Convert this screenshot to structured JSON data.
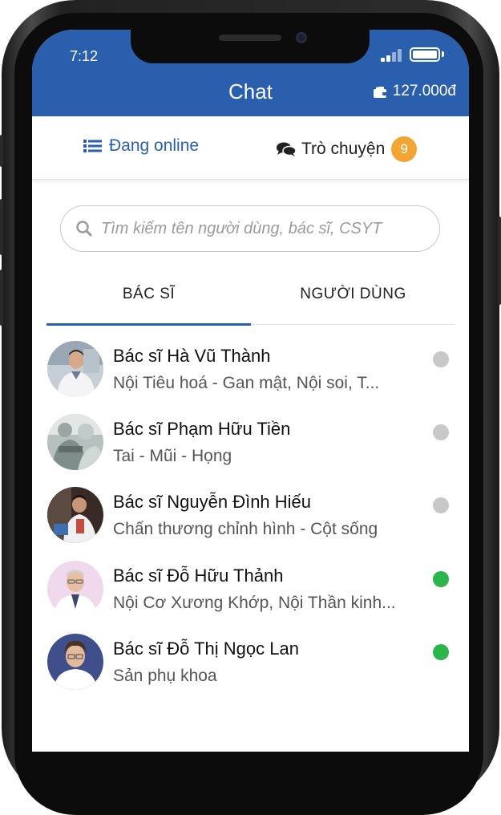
{
  "status_bar": {
    "time": "7:12"
  },
  "header": {
    "title": "Chat",
    "wallet_amount": "127.000đ"
  },
  "top_tabs": {
    "online_label": "Đang online",
    "chat_label": "Trò chuyện",
    "chat_badge": "9"
  },
  "search": {
    "placeholder": "Tìm kiếm tên người dùng, bác sĩ, CSYT"
  },
  "sub_tabs": {
    "doctors_label": "BÁC SĨ",
    "users_label": "NGƯỜI DÙNG",
    "active": "doctors"
  },
  "doctors": [
    {
      "name": "Bác sĩ Hà Vũ Thành",
      "specialty": "Nội Tiêu hoá - Gan mật, Nội soi, T...",
      "online": false
    },
    {
      "name": "Bác sĩ Phạm Hữu Tiền",
      "specialty": "Tai - Mũi - Họng",
      "online": false
    },
    {
      "name": "Bác sĩ Nguyễn Đình Hiếu",
      "specialty": "Chấn thương chỉnh hình - Cột sống",
      "online": false
    },
    {
      "name": "Bác sĩ Đỗ Hữu Thảnh",
      "specialty": "Nội Cơ Xương Khớp, Nội Thần kinh...",
      "online": true
    },
    {
      "name": "Bác sĩ Đỗ Thị Ngọc Lan",
      "specialty": "Sản phụ khoa",
      "online": true
    }
  ],
  "colors": {
    "primary": "#2a5fad",
    "badge": "#f2a532",
    "online": "#2bb54a",
    "offline": "#c8c8c8"
  }
}
